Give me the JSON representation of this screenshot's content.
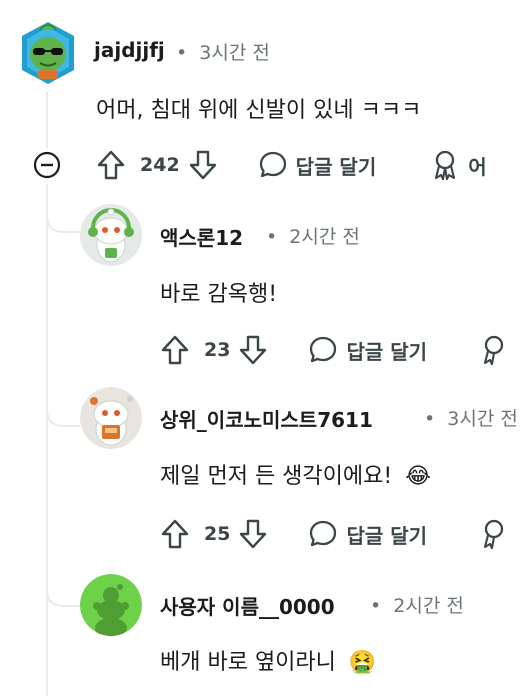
{
  "comments": [
    {
      "username": "jajdjjfj",
      "time": "3시간 전",
      "text": "어머, 침대 위에 신발이 있네 ㅋㅋㅋ",
      "score": "242",
      "reply_label": "답글 달기",
      "award_label": "어"
    },
    {
      "username": "액스론12",
      "time": "2시간 전",
      "text": "바로 감옥행!",
      "score": "23",
      "reply_label": "답글 달기"
    },
    {
      "username": "상위_이코노미스트7611",
      "time": "3시간 전",
      "text": "제일 먼저 든 생각이에요!",
      "emoji": "😂",
      "score": "25",
      "reply_label": "답글 달기"
    },
    {
      "username": "사용자 이름__0000",
      "time": "2시간 전",
      "text": "베개 바로 옆이라니",
      "emoji": "🤮"
    }
  ],
  "separator": "•",
  "colors": {
    "text": "#1c1c1c",
    "meta": "#6a7478",
    "thread_line": "#e5ebee",
    "icon": "#3c4649",
    "avatar_green": "#6dd14a"
  }
}
